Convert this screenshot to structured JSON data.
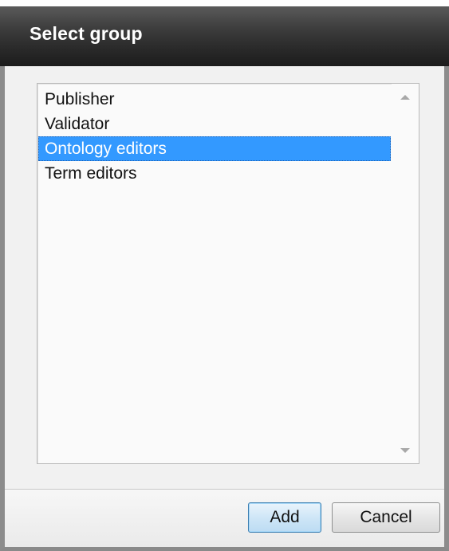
{
  "dialog": {
    "title": "Select group"
  },
  "listbox": {
    "items": [
      {
        "label": "Publisher",
        "selected": false
      },
      {
        "label": "Validator",
        "selected": false
      },
      {
        "label": "Ontology editors",
        "selected": true
      },
      {
        "label": "Term editors",
        "selected": false
      }
    ],
    "selection_color": "#3399ff"
  },
  "buttons": {
    "add_label": "Add",
    "cancel_label": "Cancel"
  },
  "icons": {
    "scroll_up": "scroll-up-arrow-icon",
    "scroll_down": "scroll-down-arrow-icon"
  }
}
